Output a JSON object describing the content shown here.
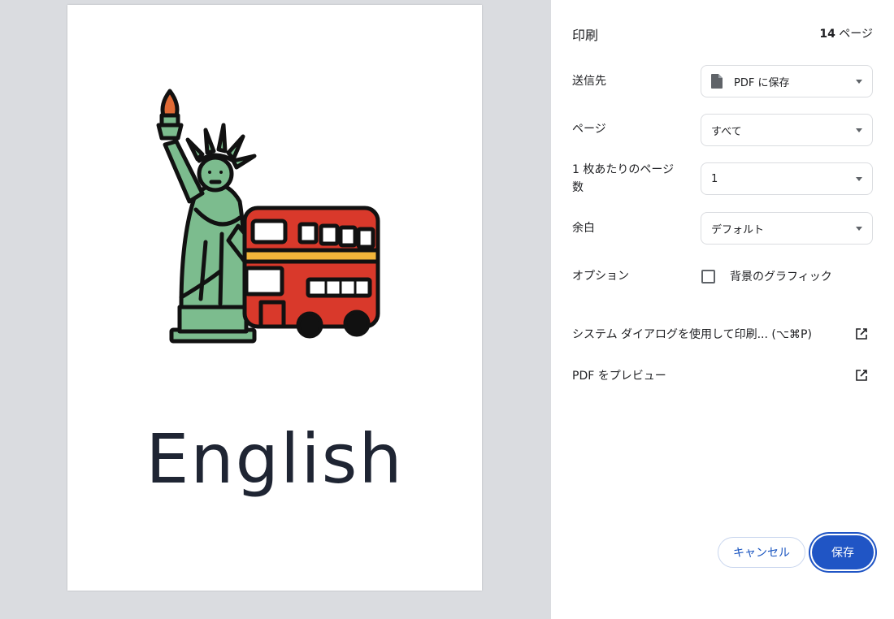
{
  "dialog": {
    "title": "印刷",
    "page_count_number": "14",
    "page_count_unit": "ページ"
  },
  "preview": {
    "page_word": "English",
    "illustration": "statue-of-liberty-and-double-decker-bus"
  },
  "settings": {
    "destination": {
      "label": "送信先",
      "value": "PDF に保存",
      "icon": "document-icon"
    },
    "pages": {
      "label": "ページ",
      "value": "すべて"
    },
    "pages_per_sheet": {
      "label": "1 枚あたりのページ数",
      "value": "1"
    },
    "margins": {
      "label": "余白",
      "value": "デフォルト"
    },
    "options": {
      "label": "オプション",
      "checkbox_label": "背景のグラフィック",
      "checked": false
    }
  },
  "links": {
    "system_dialog": "システム ダイアログを使用して印刷... (⌥⌘P)",
    "open_pdf_preview": "PDF をプレビュー"
  },
  "buttons": {
    "cancel": "キャンセル",
    "save": "保存"
  },
  "colors": {
    "preview_bg": "#dadce0",
    "accent": "#2055c5",
    "statue_green": "#7cbc8e",
    "bus_red": "#d9392b",
    "bus_stripe": "#f2b53a"
  }
}
